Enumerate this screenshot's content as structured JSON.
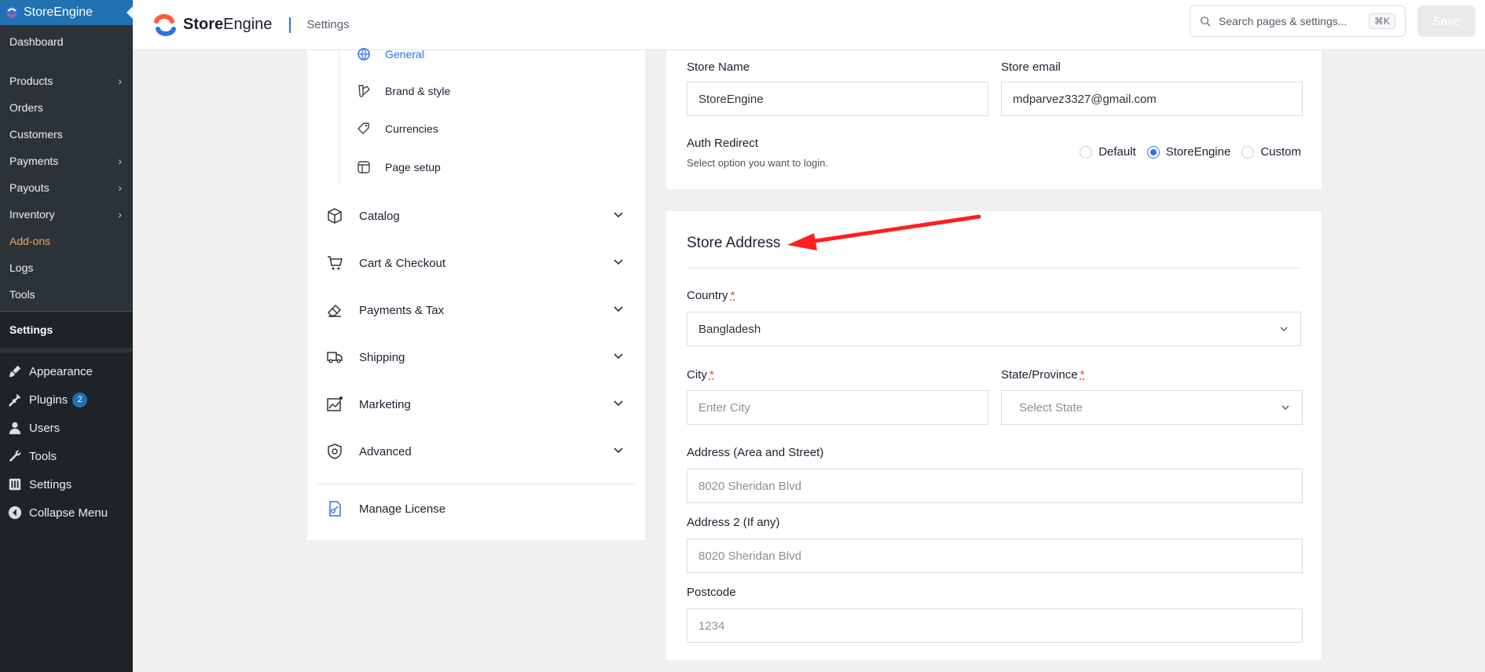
{
  "wp_sidebar": {
    "plugin_title": "StoreEngine",
    "submenu": [
      {
        "label": "Dashboard",
        "has_children": false
      },
      {
        "label": "Products",
        "has_children": true
      },
      {
        "label": "Orders",
        "has_children": false
      },
      {
        "label": "Customers",
        "has_children": false
      },
      {
        "label": "Payments",
        "has_children": true
      },
      {
        "label": "Payouts",
        "has_children": true
      },
      {
        "label": "Inventory",
        "has_children": true
      },
      {
        "label": "Add-ons",
        "has_children": false
      },
      {
        "label": "Logs",
        "has_children": false
      },
      {
        "label": "Tools",
        "has_children": false
      }
    ],
    "active_item": "Settings",
    "menu": [
      {
        "label": "Appearance",
        "icon": "paintbrush-icon"
      },
      {
        "label": "Plugins",
        "icon": "plug-icon",
        "badge": "2"
      },
      {
        "label": "Users",
        "icon": "user-icon"
      },
      {
        "label": "Tools",
        "icon": "wrench-icon"
      },
      {
        "label": "Settings",
        "icon": "sliders-icon"
      },
      {
        "label": "Collapse Menu",
        "icon": "collapse-arrow-icon"
      }
    ]
  },
  "header": {
    "brand_bold": "Store",
    "brand_light": "Engine",
    "breadcrumb": "Settings",
    "search_placeholder": "Search pages & settings...",
    "shortcut": "⌘K",
    "save_label": "Save"
  },
  "settings_nav": {
    "general_sub": [
      {
        "label": "General",
        "icon": "globe-icon",
        "active": true
      },
      {
        "label": "Brand & style",
        "icon": "palette-icon",
        "active": false
      },
      {
        "label": "Currencies",
        "icon": "tag-icon",
        "active": false
      },
      {
        "label": "Page setup",
        "icon": "page-layout-icon",
        "active": false
      }
    ],
    "groups": [
      {
        "label": "Catalog",
        "icon": "box-icon"
      },
      {
        "label": "Cart & Checkout",
        "icon": "cart-icon"
      },
      {
        "label": "Payments & Tax",
        "icon": "eraser-icon"
      },
      {
        "label": "Shipping",
        "icon": "truck-icon"
      },
      {
        "label": "Marketing",
        "icon": "chart-icon"
      },
      {
        "label": "Advanced",
        "icon": "shield-gear-icon"
      }
    ],
    "license_label": "Manage License"
  },
  "store_details": {
    "store_name_label": "Store Name",
    "store_name_value": "StoreEngine",
    "store_email_label": "Store email",
    "store_email_value": "mdparvez3327@gmail.com",
    "auth_redirect_label": "Auth Redirect",
    "auth_redirect_hint": "Select option you want to login.",
    "auth_options": [
      "Default",
      "StoreEngine",
      "Custom"
    ],
    "auth_selected": "StoreEngine"
  },
  "store_address": {
    "title": "Store Address",
    "country_label": "Country",
    "country_value": "Bangladesh",
    "city_label": "City",
    "city_placeholder": "Enter City",
    "state_label": "State/Province",
    "state_placeholder": "Select State",
    "address1_label": "Address (Area and Street)",
    "address1_placeholder": "8020 Sheridan Blvd",
    "address2_label": "Address 2 (If any)",
    "address2_placeholder": "8020 Sheridan Blvd",
    "postcode_label": "Postcode",
    "postcode_placeholder": "1234"
  },
  "colors": {
    "accent": "#2a73e8",
    "wp_sidebar": "#1d2327",
    "wp_active": "#2271b1",
    "required": "#e2483d",
    "annotation_arrow": "#ff1f1f"
  }
}
